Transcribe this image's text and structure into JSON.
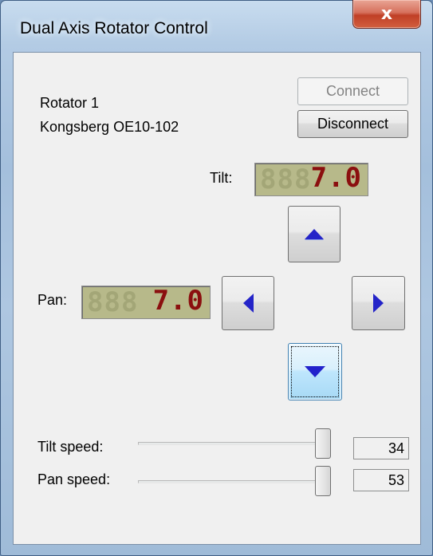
{
  "window": {
    "title": "Dual Axis Rotator Control",
    "close_glyph": "x"
  },
  "device": {
    "name": "Rotator 1",
    "model": "Kongsberg OE10-102"
  },
  "buttons": {
    "connect": "Connect",
    "disconnect": "Disconnect"
  },
  "tilt": {
    "label": "Tilt:",
    "display_value": "7.0",
    "ghost_digits": "888"
  },
  "pan": {
    "label": "Pan:",
    "display_value": "7.0",
    "ghost_digits": "888"
  },
  "arrows": {
    "up": "up-arrow-icon",
    "down": "down-arrow-icon",
    "left": "left-arrow-icon",
    "right": "right-arrow-icon"
  },
  "speeds": {
    "tilt": {
      "label": "Tilt speed:",
      "value": "34"
    },
    "pan": {
      "label": "Pan speed:",
      "value": "53"
    }
  },
  "colors": {
    "lcd_background": "#b7b98a",
    "lcd_digits": "#8b0f0f",
    "arrow_blue": "#2222cc",
    "focus_button": "#bee6fd"
  }
}
